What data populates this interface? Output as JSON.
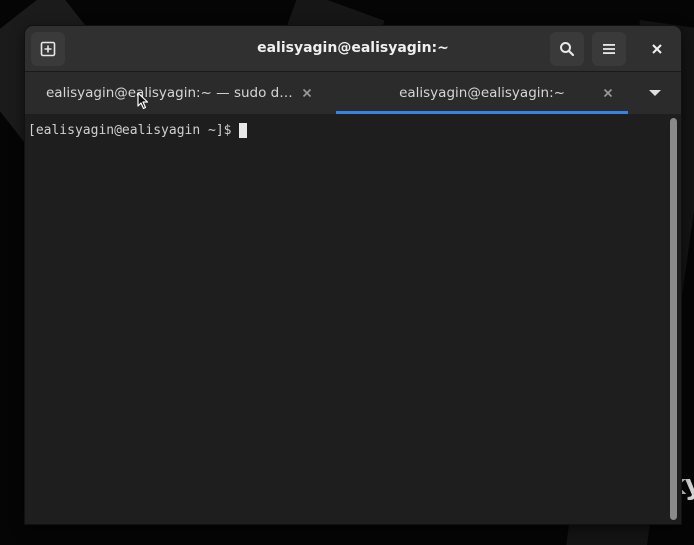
{
  "window": {
    "title": "ealisyagin@ealisyagin:~"
  },
  "headerbar": {
    "new_tab_icon": "new-tab-icon",
    "search_icon": "search-icon",
    "menu_icon": "hamburger-menu-icon",
    "close_icon": "close-icon"
  },
  "tabs": [
    {
      "label": "ealisyagin@ealisyagin:~ — sudo d…",
      "active": false
    },
    {
      "label": "ealisyagin@ealisyagin:~",
      "active": true
    }
  ],
  "terminal": {
    "prompt": "[ealisyagin@ealisyagin ~]$"
  },
  "desktop": {
    "wallpaper_text": "ky"
  },
  "colors": {
    "accent": "#3584e4",
    "headerbar": "#303030",
    "terminal_bg": "#1e1e1e"
  }
}
